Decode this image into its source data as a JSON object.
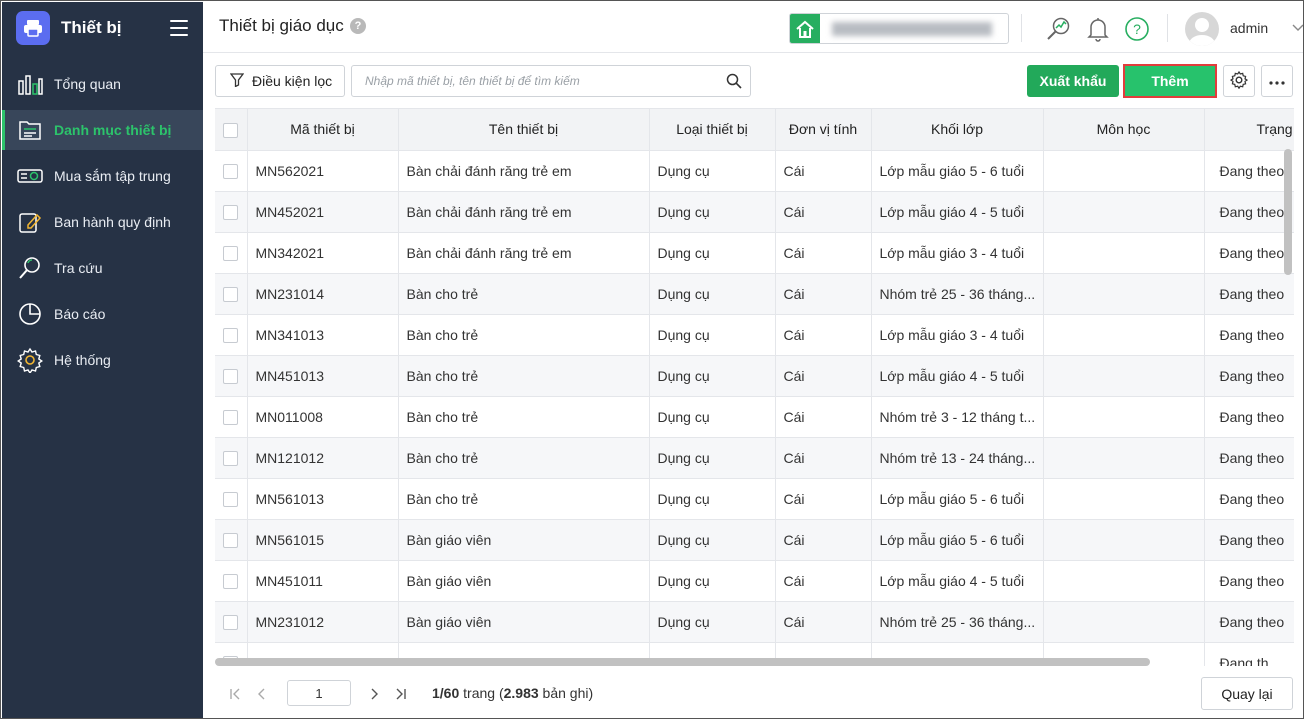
{
  "app": {
    "title": "Thiết bị"
  },
  "sidebar": {
    "items": [
      {
        "label": "Tổng quan",
        "icon": "bar-chart-icon"
      },
      {
        "label": "Danh mục thiết bị",
        "icon": "folder-list-icon",
        "active": true
      },
      {
        "label": "Mua sắm tập trung",
        "icon": "projector-icon"
      },
      {
        "label": "Ban hành quy định",
        "icon": "edit-document-icon"
      },
      {
        "label": "Tra cứu",
        "icon": "search-icon"
      },
      {
        "label": "Báo cáo",
        "icon": "pie-chart-icon"
      },
      {
        "label": "Hệ thống",
        "icon": "gear-icon"
      }
    ]
  },
  "header": {
    "title": "Thiết bị giáo dục",
    "help_badge": "?",
    "user": "admin"
  },
  "toolbar": {
    "filter_label": "Điều kiện lọc",
    "search_placeholder": "Nhập mã thiết bị, tên thiết bị để tìm kiếm",
    "export_label": "Xuất khẩu",
    "add_label": "Thêm"
  },
  "table": {
    "columns": [
      "Mã thiết bị",
      "Tên thiết bị",
      "Loại thiết bị",
      "Đơn vị tính",
      "Khối lớp",
      "Môn học",
      "Trạng"
    ],
    "rows": [
      [
        "MN562021",
        "Bàn chải đánh răng trẻ em",
        "Dụng cụ",
        "Cái",
        "Lớp mẫu giáo 5 - 6 tuổi",
        "",
        "Đang theo"
      ],
      [
        "MN452021",
        "Bàn chải đánh răng trẻ em",
        "Dụng cụ",
        "Cái",
        "Lớp mẫu giáo 4 - 5 tuổi",
        "",
        "Đang theo"
      ],
      [
        "MN342021",
        "Bàn chải đánh răng trẻ em",
        "Dụng cụ",
        "Cái",
        "Lớp mẫu giáo 3 - 4 tuổi",
        "",
        "Đang theo"
      ],
      [
        "MN231014",
        "Bàn cho trẻ",
        "Dụng cụ",
        "Cái",
        "Nhóm trẻ 25 - 36 tháng...",
        "",
        "Đang theo"
      ],
      [
        "MN341013",
        "Bàn cho trẻ",
        "Dụng cụ",
        "Cái",
        "Lớp mẫu giáo 3 - 4 tuổi",
        "",
        "Đang theo"
      ],
      [
        "MN451013",
        "Bàn cho trẻ",
        "Dụng cụ",
        "Cái",
        "Lớp mẫu giáo 4 - 5 tuổi",
        "",
        "Đang theo"
      ],
      [
        "MN011008",
        "Bàn cho trẻ",
        "Dụng cụ",
        "Cái",
        "Nhóm trẻ 3 - 12 tháng t...",
        "",
        "Đang theo"
      ],
      [
        "MN121012",
        "Bàn cho trẻ",
        "Dụng cụ",
        "Cái",
        "Nhóm trẻ 13 - 24 tháng...",
        "",
        "Đang theo"
      ],
      [
        "MN561013",
        "Bàn cho trẻ",
        "Dụng cụ",
        "Cái",
        "Lớp mẫu giáo 5 - 6 tuổi",
        "",
        "Đang theo"
      ],
      [
        "MN561015",
        "Bàn giáo viên",
        "Dụng cụ",
        "Cái",
        "Lớp mẫu giáo 5 - 6 tuổi",
        "",
        "Đang theo"
      ],
      [
        "MN451011",
        "Bàn giáo viên",
        "Dụng cụ",
        "Cái",
        "Lớp mẫu giáo 4 - 5 tuổi",
        "",
        "Đang theo"
      ],
      [
        "MN231012",
        "Bàn giáo viên",
        "Dụng cụ",
        "Cái",
        "Nhóm trẻ 25 - 36 tháng...",
        "",
        "Đang theo"
      ],
      [
        "",
        "",
        "",
        "",
        "",
        "",
        "Đang th"
      ]
    ]
  },
  "pagination": {
    "current_page": "1",
    "pages_text": "1/60",
    "trang_label": " trang (",
    "total_records": "2.983",
    "records_suffix": " bản ghi)",
    "back_label": "Quay lại"
  },
  "colors": {
    "sidebar_bg": "#263245",
    "accent_green": "#27c26c",
    "highlight_red": "#e23c3c"
  }
}
